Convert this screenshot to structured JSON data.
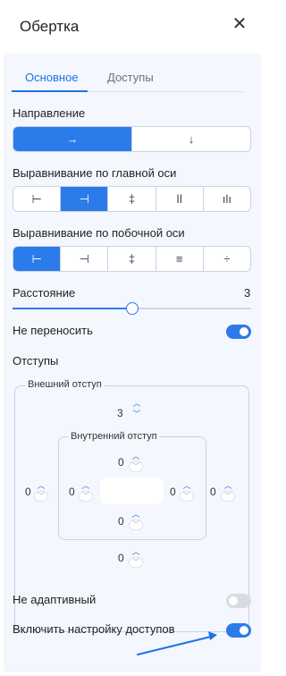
{
  "panel": {
    "title": "Обертка",
    "close_glyph": "✕"
  },
  "tabs": [
    {
      "label": "Основное",
      "active": true
    },
    {
      "label": "Доступы",
      "active": false
    }
  ],
  "direction": {
    "label": "Направление",
    "options": [
      {
        "glyph": "→",
        "icon": "arrow-right-icon",
        "selected": true
      },
      {
        "glyph": "↓",
        "icon": "arrow-down-icon",
        "selected": false
      }
    ]
  },
  "main_axis": {
    "label": "Выравнивание по главной оси",
    "options": [
      {
        "glyph": "⊢",
        "icon": "align-start-icon",
        "selected": false
      },
      {
        "glyph": "⊣",
        "icon": "align-end-icon",
        "selected": true
      },
      {
        "glyph": "‡",
        "icon": "align-center-icon",
        "selected": false
      },
      {
        "glyph": "ǀǀ",
        "icon": "space-between-icon",
        "selected": false
      },
      {
        "glyph": "ılı",
        "icon": "space-around-icon",
        "selected": false
      }
    ]
  },
  "cross_axis": {
    "label": "Выравнивание по побочной оси",
    "options": [
      {
        "glyph": "⊢",
        "icon": "align-start-icon",
        "selected": true
      },
      {
        "glyph": "⊣",
        "icon": "align-end-icon",
        "selected": false
      },
      {
        "glyph": "‡",
        "icon": "align-center-icon",
        "selected": false
      },
      {
        "glyph": "≡",
        "icon": "stretch-icon",
        "selected": false
      },
      {
        "glyph": "÷",
        "icon": "baseline-icon",
        "selected": false
      }
    ]
  },
  "spacing": {
    "label": "Расстояние",
    "value": "3",
    "fraction": 0.5
  },
  "nowrap": {
    "label": "Не переносить",
    "on": true
  },
  "paddings": {
    "label": "Отступы",
    "outer_title": "Внешний отступ",
    "inner_title": "Внутренний отступ",
    "outer_top": "3",
    "outer_left": "0",
    "outer_right": "0",
    "outer_bottom": "0",
    "inner_top": "0",
    "inner_left": "0",
    "inner_right": "0",
    "inner_bottom": "0"
  },
  "not_adaptive": {
    "label": "Не адаптивный",
    "on": false
  },
  "enable_access": {
    "label": "Включить настройку доступов",
    "on": true
  },
  "colors": {
    "accent": "#2c7bea",
    "annotation_arrow": "#1d73e8"
  }
}
